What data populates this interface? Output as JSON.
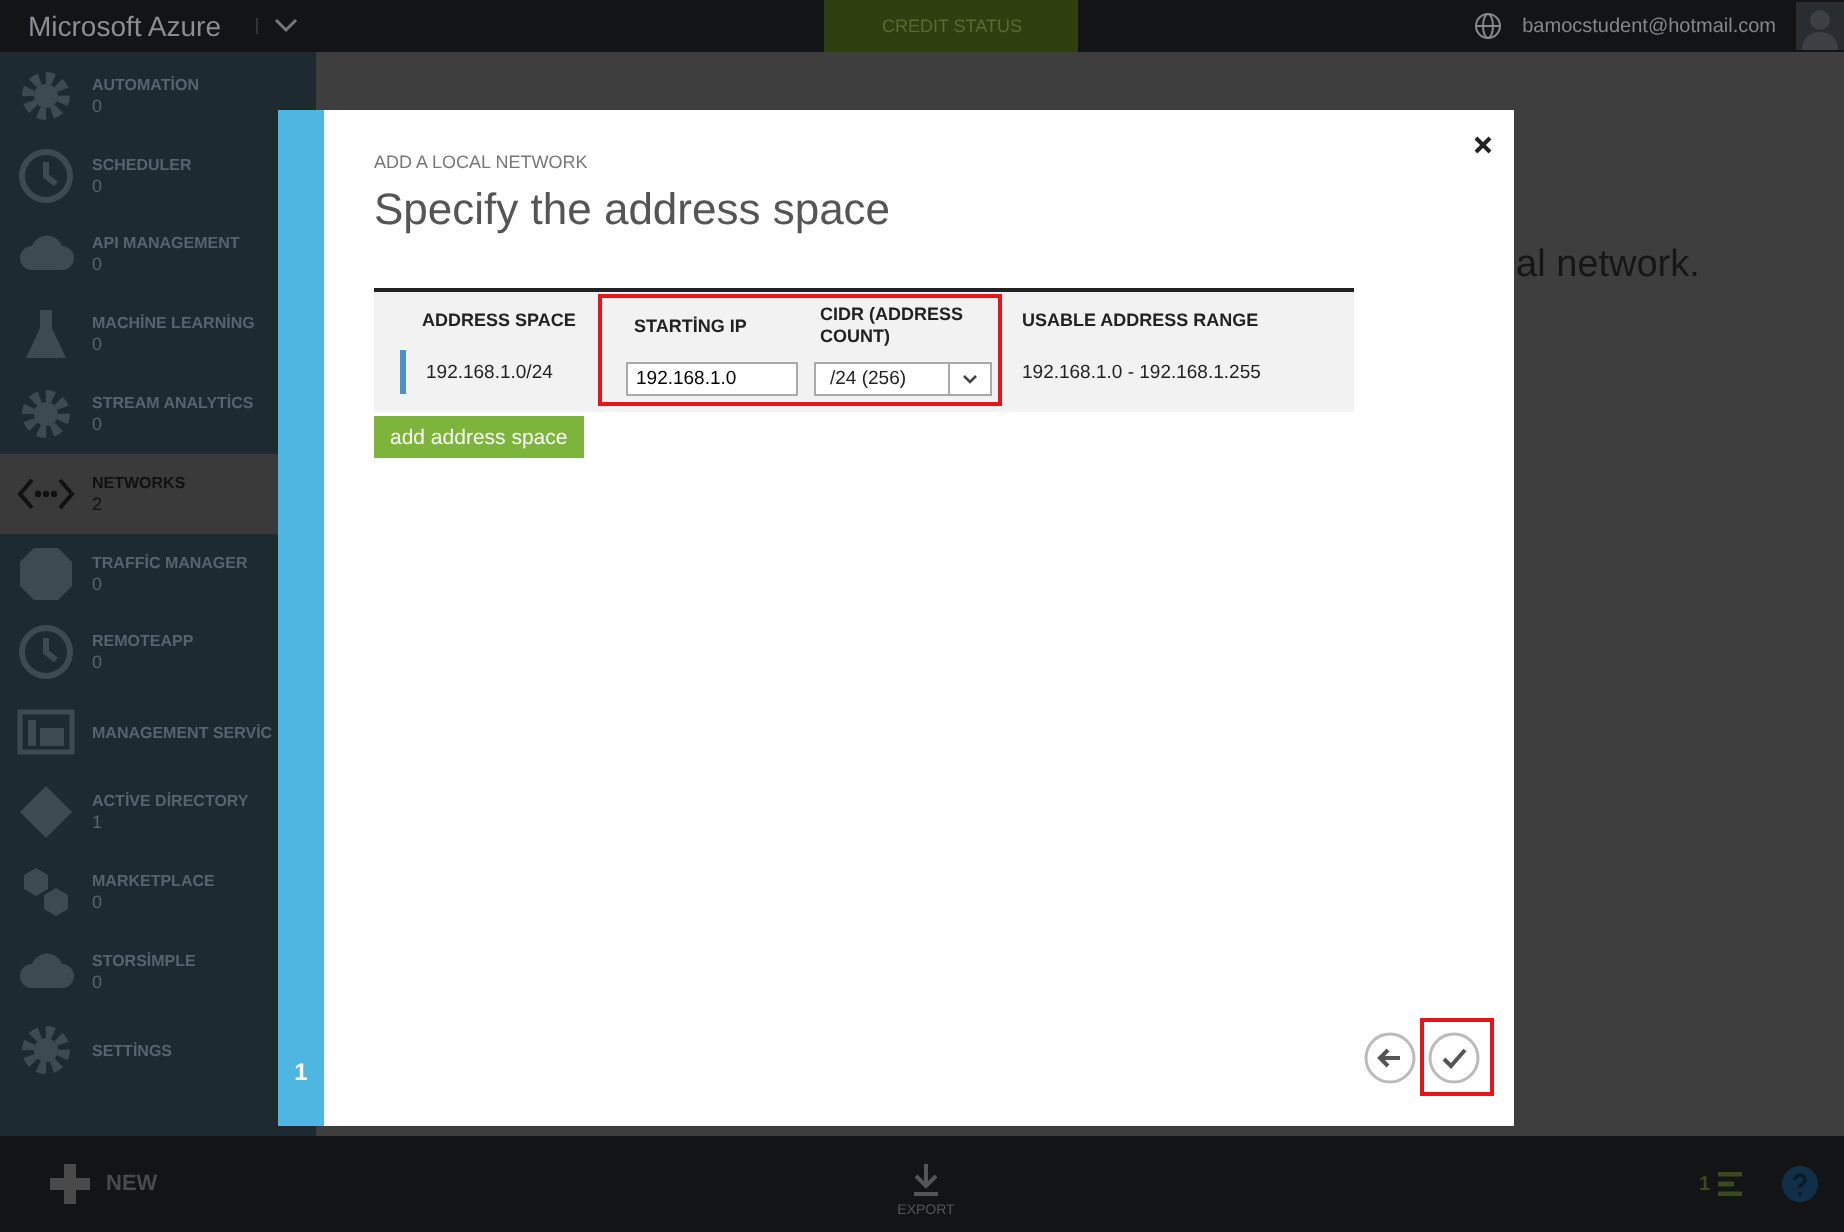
{
  "top_bar": {
    "brand": "Microsoft Azure",
    "credit_status": "CREDIT STATUS",
    "user": "bamocstudent@hotmail.com"
  },
  "sidebar": {
    "items": [
      {
        "name": "AUTOMATİON",
        "count": "0",
        "selected": false
      },
      {
        "name": "SCHEDULER",
        "count": "0",
        "selected": false
      },
      {
        "name": "API MANAGEMENT",
        "count": "0",
        "selected": false
      },
      {
        "name": "MACHİNE LEARNİNG",
        "count": "0",
        "selected": false
      },
      {
        "name": "STREAM ANALYTİCS",
        "count": "0",
        "selected": false
      },
      {
        "name": "NETWORKS",
        "count": "2",
        "selected": true
      },
      {
        "name": "TRAFFİC MANAGER",
        "count": "0",
        "selected": false
      },
      {
        "name": "REMOTEAPP",
        "count": "0",
        "selected": false
      },
      {
        "name": "MANAGEMENT SERVİC",
        "selected": false
      },
      {
        "name": "ACTİVE DİRECTORY",
        "count": "1",
        "selected": false
      },
      {
        "name": "MARKETPLACE",
        "count": "0",
        "selected": false
      },
      {
        "name": "STORSİMPLE",
        "count": "0",
        "selected": false
      },
      {
        "name": "SETTİNGS",
        "selected": false
      }
    ]
  },
  "background_page": {
    "text": "al network."
  },
  "dialog": {
    "step": "1",
    "eyebrow": "ADD A LOCAL NETWORK",
    "title": "Specify the address space",
    "table": {
      "highlighted": true,
      "columns": [
        "ADDRESS SPACE",
        "STARTİNG IP",
        "CIDR (ADDRESS COUNT)",
        "USABLE ADDRESS RANGE"
      ],
      "row": {
        "address_space": "192.168.1.0/24",
        "starting_ip": "192.168.1.0",
        "cidr": "/24 (256)",
        "usable_range": "192.168.1.0 - 192.168.1.255"
      }
    },
    "add_button": "add address space",
    "confirm": {
      "highlighted": true
    }
  },
  "bottom_bar": {
    "new": "NEW",
    "export": "EXPORT",
    "notifications": "1"
  }
}
